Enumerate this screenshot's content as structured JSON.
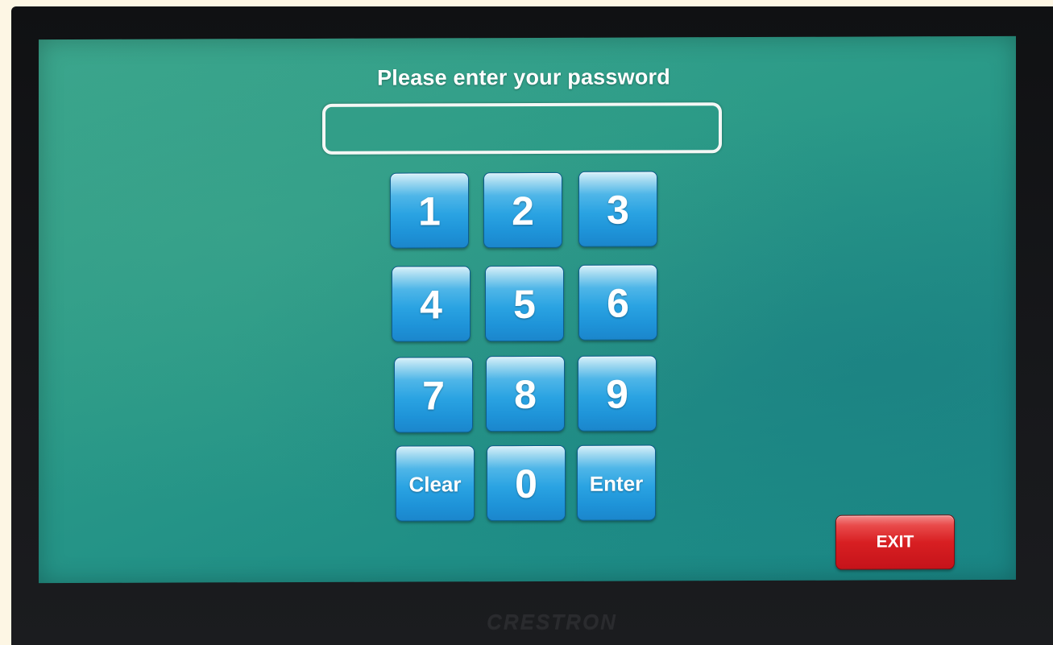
{
  "prompt": {
    "title": "Please enter your password"
  },
  "password": {
    "value": ""
  },
  "keypad": {
    "keys": [
      "1",
      "2",
      "3",
      "4",
      "5",
      "6",
      "7",
      "8",
      "9",
      "Clear",
      "0",
      "Enter"
    ]
  },
  "exit": {
    "label": "EXIT"
  },
  "device": {
    "brand": "CRESTRON"
  },
  "colors": {
    "screen": "#2b9a88",
    "key": "#2aa3e2",
    "exit": "#d81f22"
  }
}
